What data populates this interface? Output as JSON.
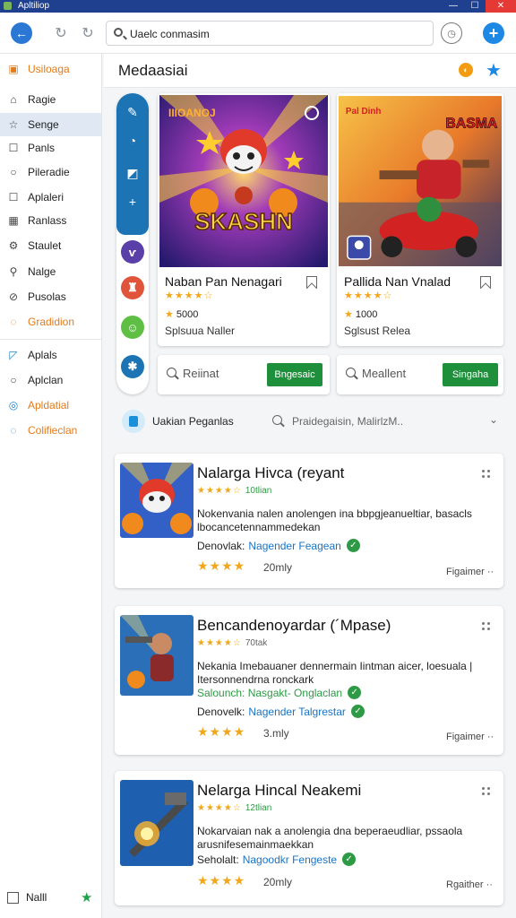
{
  "window": {
    "title": "Apltiliop"
  },
  "nav": {
    "url_value": "Uaelc conmasim"
  },
  "sidebar": {
    "items": [
      {
        "label": "Usiloaga",
        "icon": "store-icon",
        "style": "orange"
      },
      {
        "label": "Ragie",
        "icon": "home-icon",
        "style": "normal"
      },
      {
        "label": "Senge",
        "icon": "star-outline-icon",
        "style": "active"
      },
      {
        "label": "Panls",
        "icon": "square-icon",
        "style": "normal"
      },
      {
        "label": "Pileradie",
        "icon": "circle-icon",
        "style": "normal"
      },
      {
        "label": "Aplaleri",
        "icon": "square-icon",
        "style": "normal"
      },
      {
        "label": "Ranlass",
        "icon": "grid-icon",
        "style": "normal"
      },
      {
        "label": "Staulet",
        "icon": "gear-icon",
        "style": "normal"
      },
      {
        "label": "Nalge",
        "icon": "search-icon",
        "style": "normal"
      },
      {
        "label": "Pusolas",
        "icon": "block-icon",
        "style": "normal"
      },
      {
        "label": "Gradidion",
        "icon": "chat-icon",
        "style": "orange"
      },
      {
        "label": "Aplals",
        "icon": "tag-icon",
        "style": "normal"
      },
      {
        "label": "Aplclan",
        "icon": "circle-icon",
        "style": "normal"
      },
      {
        "label": "Apldatial",
        "icon": "globe-icon",
        "style": "orange"
      },
      {
        "label": "Colifieclan",
        "icon": "chat-icon",
        "style": "blue"
      }
    ],
    "footer_label": "Nalll"
  },
  "header": {
    "title": "Medaasiai"
  },
  "featured": [
    {
      "art_title": "SKASHN",
      "art_badge": "IIIOANOJ",
      "name": "Naban Pan Nenagari",
      "rating": "★★★★☆",
      "count": "5000",
      "subtitle": "Splsuua Naller"
    },
    {
      "art_title": "BASMA",
      "art_badge": "Pal Dinh",
      "name": "Pallida Nan Vnalad",
      "rating": "★★★★☆",
      "count": "1000",
      "subtitle": "Sglsust Relea"
    }
  ],
  "search_boxes": [
    {
      "placeholder": "Reiinat",
      "button": "Bngesaic"
    },
    {
      "placeholder": "Meallent",
      "button": "Singaha"
    }
  ],
  "category_bar": {
    "label": "Uakian Peganlas",
    "search_text": "Praidegaisin, MalirlzM.."
  },
  "apps": [
    {
      "name": "Nalarga Hivca (reyant",
      "rating": "★★★★☆",
      "rating_count": "10tlian",
      "description": "Nokenvania nalen anolengen ina bbpgjeanueltiar, basacls lbocancetennammedekan",
      "dev_rows": [
        {
          "label": "Denovlak:",
          "value": "Nagender Feagean",
          "green": false
        }
      ],
      "bottom_rating": "★★★★",
      "bottom_count": "20mly",
      "more": "Figaimer ··"
    },
    {
      "name": "Bencandenoyardar (´Mpase)",
      "rating": "★★★★☆",
      "rating_count": "70tak",
      "description": "Nekania Imebauaner dennermain Iintman aicer, loesuala | Itersonnendrna ronckark",
      "dev_rows": [
        {
          "label": "Salounch: Nasgakt- Onglaclan",
          "value": "",
          "green": true
        },
        {
          "label": "Denovelk:",
          "value": "Nagender Talgrestar",
          "green": false
        }
      ],
      "bottom_rating": "★★★★",
      "bottom_count": "3.mly",
      "more": "Figaimer ··"
    },
    {
      "name": "Nelarga Hincal Neakemi",
      "rating": "★★★★☆",
      "rating_count": "12tlian",
      "description": "Nokarvaian nak a anolengia dna beperaeudliar, pssaola arusnifesemainmaekkan",
      "dev_rows": [
        {
          "label": "Seholalt:",
          "value": "Nagoodkr Fengeste",
          "green": false
        }
      ],
      "bottom_rating": "★★★★",
      "bottom_count": "20mly",
      "more": "Rgaither ··"
    }
  ],
  "colors": {
    "titlebar": "#1f3f8f",
    "accent_blue": "#1e88e5",
    "green": "#1e8f3a",
    "star": "#f2a71b",
    "orange": "#e27b1c"
  }
}
